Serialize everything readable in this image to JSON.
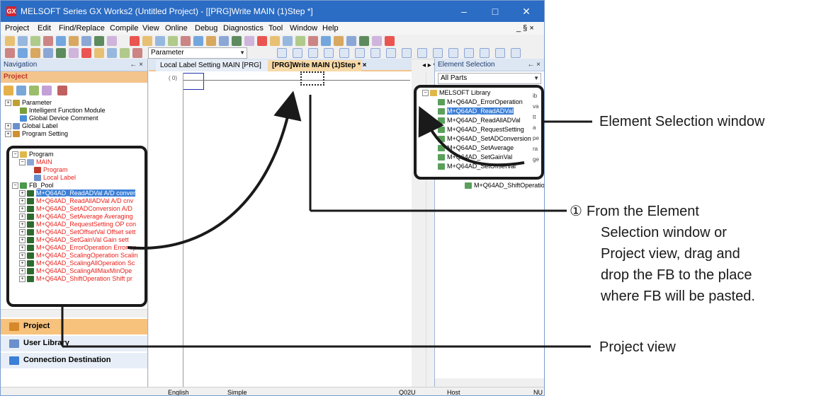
{
  "window": {
    "title": "MELSOFT Series GX Works2 (Untitled Project) - [[PRG]Write MAIN (1)Step *]",
    "app_icon_text": "GX",
    "minimize": "–",
    "maximize": "□",
    "close": "✕",
    "mdi_controls": "_ § ×"
  },
  "menu": [
    "Project",
    "Edit",
    "Find/Replace",
    "Compile",
    "View",
    "Online",
    "Debug",
    "Diagnostics",
    "Tool",
    "Window",
    "Help"
  ],
  "toolbar": {
    "combo_parameter": "Parameter"
  },
  "navigation": {
    "header": "Navigation",
    "pin": "← ×",
    "project_header": "Project",
    "top_tree": [
      {
        "label": "Parameter",
        "level": 0,
        "exp": "+",
        "icon": "#c0a030",
        "red": false
      },
      {
        "label": "Intelligent Function Module",
        "level": 1,
        "exp": "",
        "icon": "#7a9e3a",
        "red": false
      },
      {
        "label": "Global Device Comment",
        "level": 1,
        "exp": "",
        "icon": "#4a8ed8",
        "red": false
      },
      {
        "label": "Global Label",
        "level": 0,
        "exp": "+",
        "icon": "#6a8fcc",
        "red": false
      },
      {
        "label": "Program Setting",
        "level": 0,
        "exp": "+",
        "icon": "#d09030",
        "red": false
      }
    ],
    "program_tree": [
      {
        "label": "Program",
        "level": 0,
        "exp": "−",
        "icon": "#e0b84a",
        "red": false
      },
      {
        "label": "MAIN",
        "level": 1,
        "exp": "−",
        "icon": "#8aa6d6",
        "red": true
      },
      {
        "label": "Program",
        "level": 2,
        "exp": "",
        "icon": "#c0392b",
        "red": true
      },
      {
        "label": "Local Label",
        "level": 2,
        "exp": "",
        "icon": "#6a8fcc",
        "red": true
      },
      {
        "label": "FB_Pool",
        "level": 0,
        "exp": "−",
        "icon": "#4a9a4a",
        "red": false
      },
      {
        "label": "M+Q64AD_ReadADVal A/D conver",
        "level": 1,
        "exp": "+",
        "icon": "#2d6a2d",
        "red": false,
        "selected": true
      },
      {
        "label": "M+Q64AD_ReadAllADVal A/D cnv",
        "level": 1,
        "exp": "+",
        "icon": "#2d6a2d",
        "red": true
      },
      {
        "label": "M+Q64AD_SetADConversion A/D",
        "level": 1,
        "exp": "+",
        "icon": "#2d6a2d",
        "red": true
      },
      {
        "label": "M+Q64AD_SetAverage Averaging",
        "level": 1,
        "exp": "+",
        "icon": "#2d6a2d",
        "red": true
      },
      {
        "label": "M+Q64AD_RequestSetting OP con",
        "level": 1,
        "exp": "+",
        "icon": "#2d6a2d",
        "red": true
      },
      {
        "label": "M+Q64AD_SetOffsetVal Offset sett",
        "level": 1,
        "exp": "+",
        "icon": "#2d6a2d",
        "red": true
      },
      {
        "label": "M+Q64AD_SetGainVal Gain sett",
        "level": 1,
        "exp": "+",
        "icon": "#2d6a2d",
        "red": true
      },
      {
        "label": "M+Q64AD_ErrorOperation Error op",
        "level": 1,
        "exp": "+",
        "icon": "#2d6a2d",
        "red": true
      },
      {
        "label": "M+Q64AD_ScalingOperation Scalin",
        "level": 1,
        "exp": "+",
        "icon": "#2d6a2d",
        "red": true
      },
      {
        "label": "M+Q64AD_ScalingAllOperation Sc",
        "level": 1,
        "exp": "+",
        "icon": "#2d6a2d",
        "red": true
      },
      {
        "label": "M+Q64AD_ScalingAllMaxMinOpe",
        "level": 1,
        "exp": "+",
        "icon": "#2d6a2d",
        "red": true
      },
      {
        "label": "M+Q64AD_ShiftOperation Shift pr",
        "level": 1,
        "exp": "+",
        "icon": "#2d6a2d",
        "red": true
      }
    ],
    "tabs": [
      "Project",
      "User Library",
      "Connection Destination"
    ]
  },
  "editor": {
    "tabs": [
      "Local Label Setting MAIN [PRG]",
      "[PRG]Write MAIN (1)Step *"
    ],
    "tab_close": "×",
    "row_number": "( 0)"
  },
  "element_selection": {
    "header": "Element Selection",
    "pin": "← ×",
    "filter": "All Parts",
    "tree_root": "MELSOFT Library",
    "items": [
      "M+Q64AD_ErrorOperation",
      "M+Q64AD_ReadADVal",
      "M+Q64AD_ReadAllADVal",
      "M+Q64AD_RequestSetting",
      "M+Q64AD_SetADConversion",
      "M+Q64AD_SetAverage",
      "M+Q64AD_SetGainVal",
      "M+Q64AD_SetOffsetVal"
    ],
    "tail_item": "M+Q64AD_ShiftOperatio",
    "right_fragments": [
      "ib",
      "va",
      "tt",
      "a",
      "pe",
      "ra",
      "ge"
    ]
  },
  "status": {
    "language": "English",
    "mode": "Simple",
    "cpu": "Q02U",
    "connection": "Host",
    "num": "NU"
  },
  "callouts": {
    "element_selection": "Element Selection window",
    "step_number": "①",
    "step_line1": "From the Element",
    "step_line2": "Selection window or",
    "step_line3": "Project view, drag and",
    "step_line4": "drop the FB to the place",
    "step_line5": "where FB will be pasted.",
    "project_view": "Project view"
  }
}
